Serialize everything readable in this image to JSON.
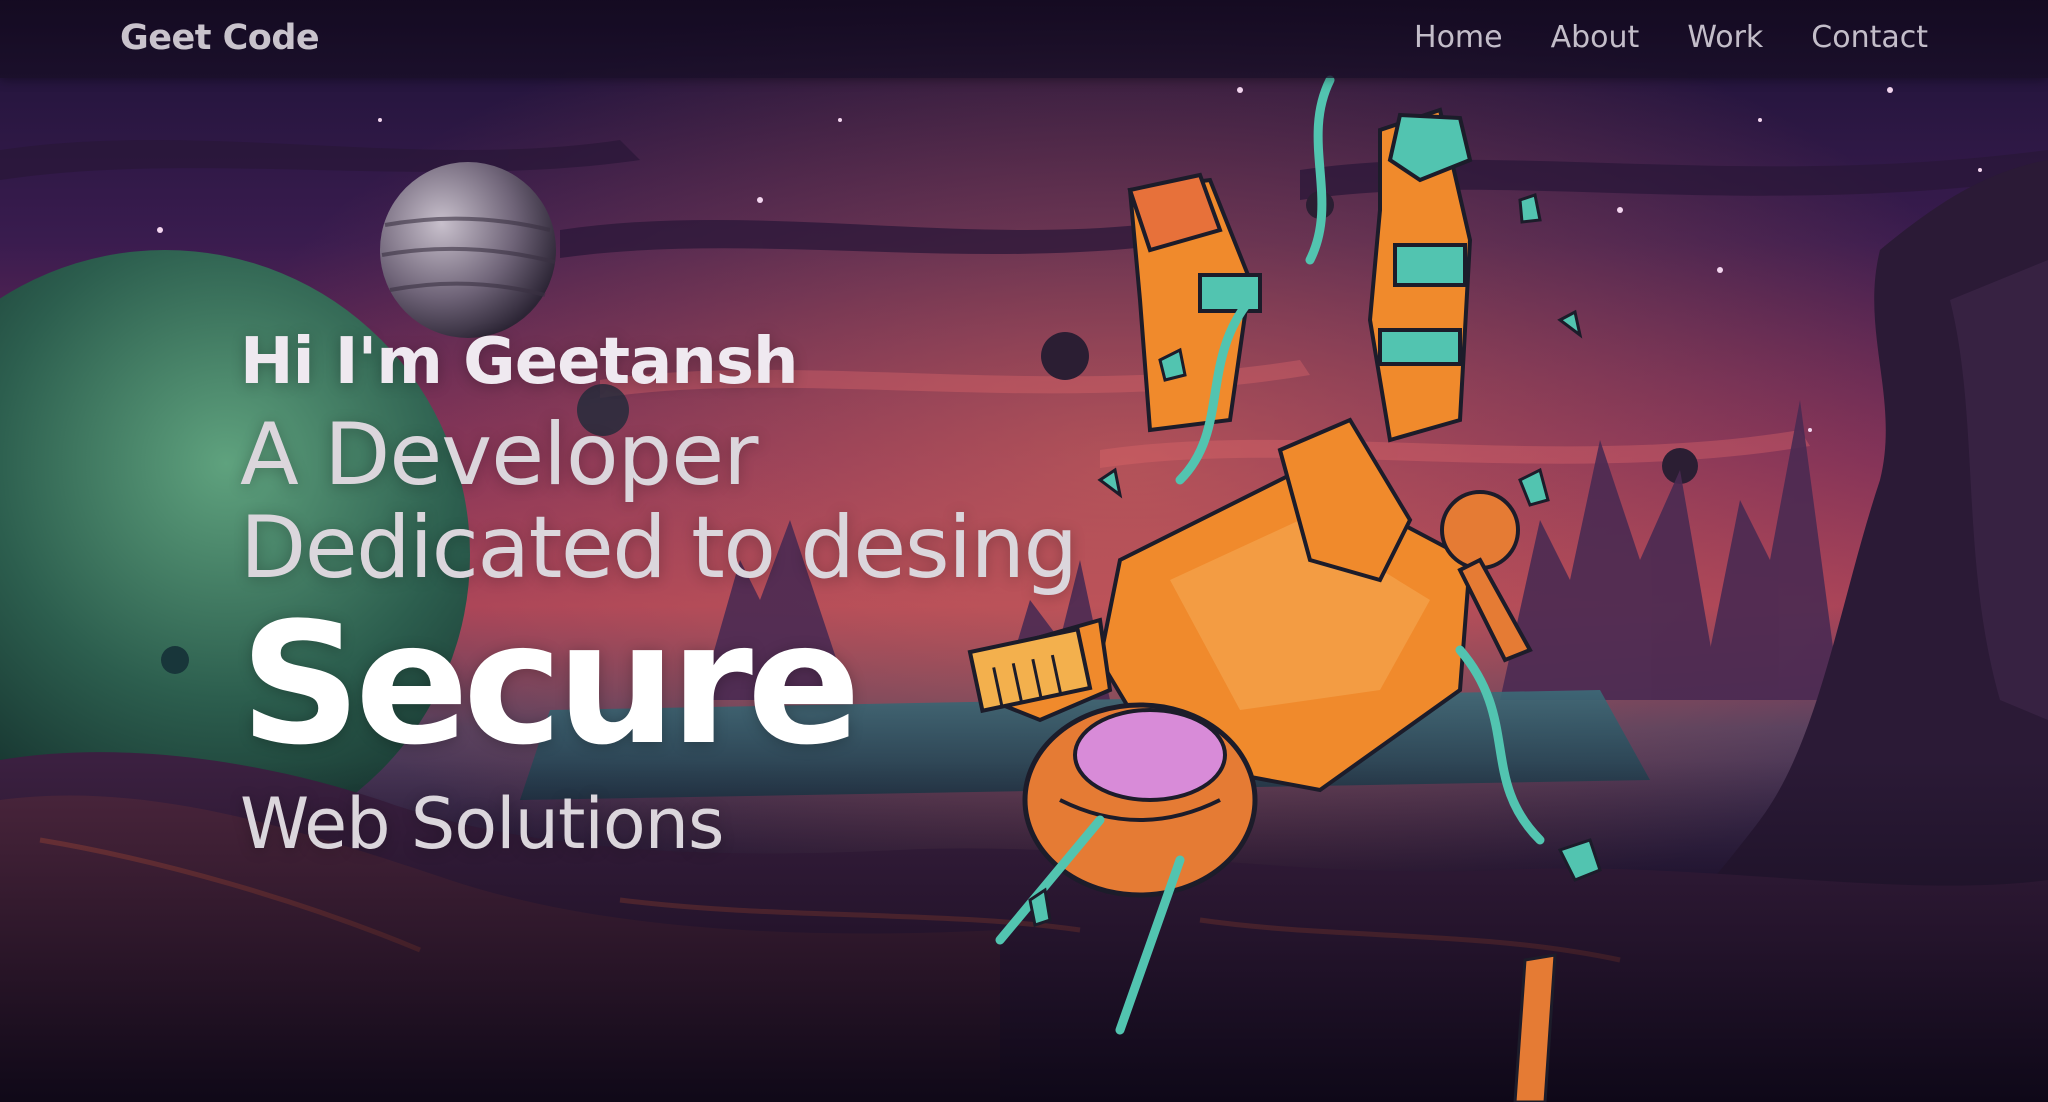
{
  "header": {
    "brand": "Geet Code",
    "nav": {
      "home": "Home",
      "about": "About",
      "work": "Work",
      "contact": "Contact"
    }
  },
  "hero": {
    "greeting": "Hi I'm Geetansh",
    "role": "A Developer",
    "tagline": "Dedicated to desing",
    "highlight": "Secure",
    "subtitle": "Web Solutions"
  },
  "colors": {
    "nav_background": "#160c24",
    "sky_top": "#1c1238",
    "sky_glow": "#b0405f",
    "planet_green": "#2f6b57",
    "astronaut_orange": "#f08a2c",
    "astronaut_teal": "#52c4b0",
    "rock_purple": "#3a2347"
  },
  "icons": {
    "background": "space-landscape-illustration",
    "character": "falling-astronaut-illustration"
  }
}
